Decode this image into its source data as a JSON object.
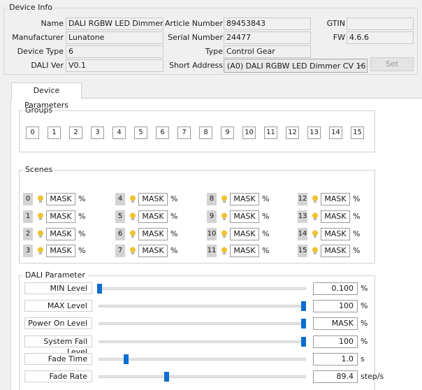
{
  "device_info": {
    "title": "Device Info",
    "name_label": "Name",
    "name_value": "DALI RGBW LED Dimmer ...",
    "manufacturer_label": "Manufacturer",
    "manufacturer_value": "Lunatone",
    "device_type_label": "Device Type",
    "device_type_value": "6",
    "dali_ver_label": "DALI Ver",
    "dali_ver_value": "V0.1",
    "article_label": "Article Number",
    "article_value": "89453843",
    "serial_label": "Serial Number",
    "serial_value": "24477",
    "type_label": "Type",
    "type_value": "Control Gear",
    "short_address_label": "Short Address",
    "short_address_value": "(A0) DALI RGBW LED Dimmer CV 16",
    "gtin_label": "GTIN",
    "gtin_value": "",
    "fw_label": "FW",
    "fw_value": "4.6.6",
    "set_button": "Set"
  },
  "tab": {
    "label": "Device Parameters"
  },
  "groups": {
    "title": "Groups",
    "items": [
      "0",
      "1",
      "2",
      "3",
      "4",
      "5",
      "6",
      "7",
      "8",
      "9",
      "10",
      "11",
      "12",
      "13",
      "14",
      "15"
    ]
  },
  "scenes": {
    "title": "Scenes",
    "items": [
      {
        "num": "0",
        "value": "MASK",
        "unit": "%"
      },
      {
        "num": "1",
        "value": "MASK",
        "unit": "%"
      },
      {
        "num": "2",
        "value": "MASK",
        "unit": "%"
      },
      {
        "num": "3",
        "value": "MASK",
        "unit": "%"
      },
      {
        "num": "4",
        "value": "MASK",
        "unit": "%"
      },
      {
        "num": "5",
        "value": "MASK",
        "unit": "%"
      },
      {
        "num": "6",
        "value": "MASK",
        "unit": "%"
      },
      {
        "num": "7",
        "value": "MASK",
        "unit": "%"
      },
      {
        "num": "8",
        "value": "MASK",
        "unit": "%"
      },
      {
        "num": "9",
        "value": "MASK",
        "unit": "%"
      },
      {
        "num": "10",
        "value": "MASK",
        "unit": "%"
      },
      {
        "num": "11",
        "value": "MASK",
        "unit": "%"
      },
      {
        "num": "12",
        "value": "MASK",
        "unit": "%"
      },
      {
        "num": "13",
        "value": "MASK",
        "unit": "%"
      },
      {
        "num": "14",
        "value": "MASK",
        "unit": "%"
      },
      {
        "num": "15",
        "value": "MASK",
        "unit": "%"
      }
    ]
  },
  "dali_parameter": {
    "title": "DALI Parameter",
    "rows": [
      {
        "label": "MIN Level",
        "value": "0.100",
        "unit": "%",
        "level": 0.0
      },
      {
        "label": "MAX Level",
        "value": "100",
        "unit": "%",
        "level": 1.0
      },
      {
        "label": "Power On Level",
        "value": "MASK",
        "unit": "%",
        "level": 1.0
      },
      {
        "label": "System Fail Level",
        "value": "100",
        "unit": "%",
        "level": 1.0
      },
      {
        "label": "Fade Time",
        "value": "1.0",
        "unit": "s",
        "level": 0.13
      },
      {
        "label": "Fade Rate",
        "value": "89.4",
        "unit": "step/s",
        "level": 0.33
      }
    ]
  },
  "colors": {
    "slider_thumb": "#0a6ed1",
    "bulb": "#f2c230"
  }
}
